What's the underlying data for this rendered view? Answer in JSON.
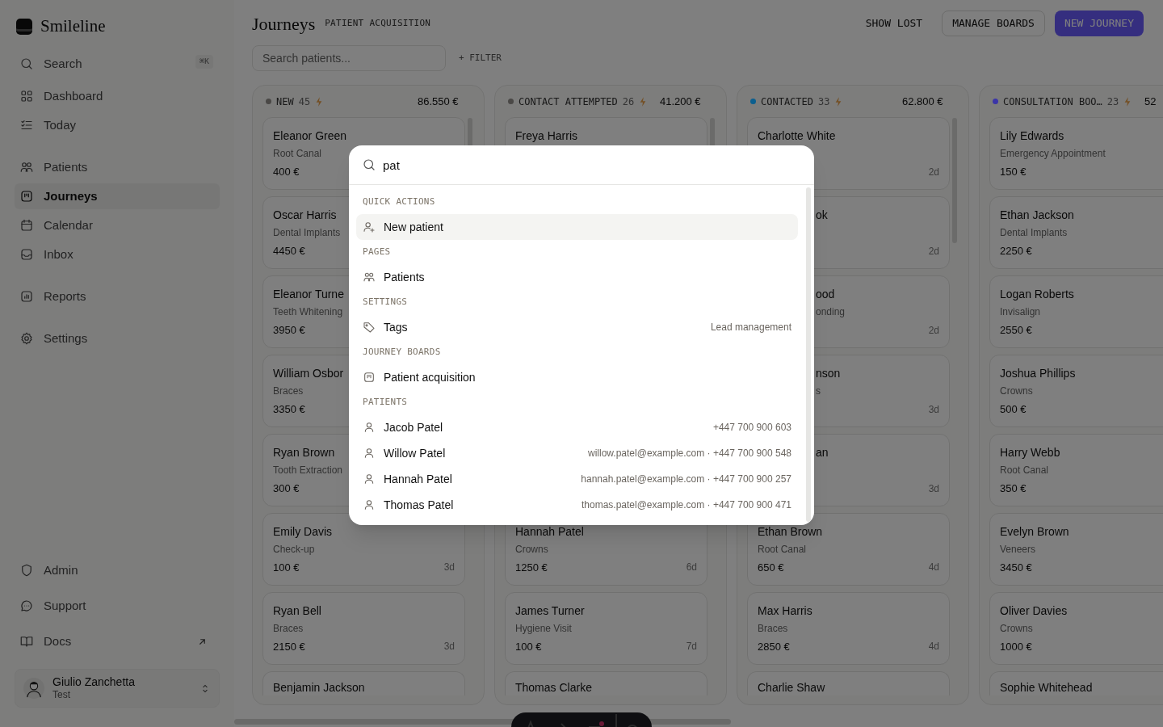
{
  "app": {
    "name": "Smileline"
  },
  "sidebar": {
    "search": {
      "label": "Search",
      "shortcut": "⌘K"
    },
    "sections": [
      [
        {
          "label": "Dashboard",
          "selected": false
        },
        {
          "label": "Today",
          "selected": false
        }
      ],
      [
        {
          "label": "Patients",
          "selected": false
        },
        {
          "label": "Journeys",
          "selected": true
        },
        {
          "label": "Calendar",
          "selected": false
        },
        {
          "label": "Inbox",
          "selected": false
        }
      ],
      [
        {
          "label": "Reports",
          "selected": false
        }
      ],
      [
        {
          "label": "Settings",
          "selected": false
        }
      ]
    ],
    "footer_items": [
      {
        "label": "Admin",
        "external": false
      },
      {
        "label": "Support",
        "external": false
      },
      {
        "label": "Docs",
        "external": true
      }
    ],
    "user": {
      "name": "Giulio Zanchetta",
      "role": "Test"
    }
  },
  "header": {
    "title": "Journeys",
    "subtitle": "PATIENT ACQUISITION",
    "buttons": [
      {
        "label": "SHOW LOST",
        "kind": "plain"
      },
      {
        "label": "MANAGE BOARDS",
        "kind": "outline"
      },
      {
        "label": "NEW JOURNEY",
        "kind": "primary"
      }
    ]
  },
  "toolbar": {
    "search_placeholder": "Search patients...",
    "filter": "+ FILTER"
  },
  "columns": [
    {
      "title": "NEW",
      "count": "45",
      "total": "86.550 €",
      "color": "#4a4846",
      "cards": [
        {
          "name": "Eleanor Green",
          "treatment": "Root Canal",
          "price": "400 €"
        },
        {
          "name": "Oscar Harris",
          "treatment": "Dental Implants",
          "price": "4450 €"
        },
        {
          "name": "Eleanor Turne",
          "treatment": "Teeth Whitening",
          "price": "3950 €"
        },
        {
          "name": "William Osbor",
          "treatment": "Braces",
          "price": "3350 €"
        },
        {
          "name": "Ryan Brown",
          "treatment": "Tooth Extraction",
          "price": "300 €"
        },
        {
          "name": "Emily Davis",
          "treatment": "Check-up",
          "price": "100 €",
          "age": "3d"
        },
        {
          "name": "Ryan Bell",
          "treatment": "Braces",
          "price": "2150 €",
          "age": "3d"
        },
        {
          "name": "Benjamin Jackson",
          "kind": "cut"
        }
      ]
    },
    {
      "title": "CONTACT ATTEMPTED",
      "count": "26",
      "total": "41.200 €",
      "color": "#4a4846",
      "cards": [
        {
          "name": "Freya Harris"
        },
        {
          "name": "Hannah Patel",
          "treatment": "Crowns",
          "price": "1250 €",
          "age": "6d"
        },
        {
          "name": "James Turner",
          "treatment": "Hygiene Visit",
          "price": "100 €",
          "age": "7d"
        },
        {
          "name": "Thomas Clarke",
          "kind": "cut"
        }
      ]
    },
    {
      "title": "CONTACTED",
      "count": "33",
      "total": "62.800 €",
      "color": "#0b5f8f",
      "cards": [
        {
          "name": "Charlotte White",
          "age": "2d"
        },
        {
          "name": "ok",
          "age": "2d",
          "kind": "partial"
        },
        {
          "name": "ood",
          "treatment": "onding",
          "age": "2d",
          "kind": "partial"
        },
        {
          "name": "nson",
          "treatment": "s",
          "age": "3d",
          "kind": "partial"
        },
        {
          "name": "an",
          "age": "3d",
          "kind": "partial"
        },
        {
          "name": "Ethan Brown",
          "treatment": "Root Canal",
          "price": "650 €",
          "age": "4d"
        },
        {
          "name": "Max Harris",
          "treatment": "Braces",
          "price": "2850 €",
          "age": "4d"
        },
        {
          "name": "Charlie Shaw",
          "kind": "cut"
        }
      ]
    },
    {
      "title": "CONSULTATION BOO…",
      "count": "23",
      "total": "52",
      "color": "#3b35a8",
      "cards": [
        {
          "name": "Lily Edwards",
          "treatment": "Emergency Appointment",
          "price": "150 €"
        },
        {
          "name": "Ethan Jackson",
          "treatment": "Dental Implants",
          "price": "2250 €"
        },
        {
          "name": "Logan Roberts",
          "treatment": "Invisalign",
          "price": "2550 €"
        },
        {
          "name": "Joshua Phillips",
          "treatment": "Crowns",
          "price": "500 €"
        },
        {
          "name": "Harry Webb",
          "treatment": "Root Canal",
          "price": "350 €"
        },
        {
          "name": "Evelyn Brown",
          "treatment": "Veneers",
          "price": "3450 €"
        },
        {
          "name": "Oliver Davies",
          "treatment": "Crowns",
          "price": "1000 €"
        },
        {
          "name": "Sophie Whitehead",
          "kind": "cut"
        }
      ]
    }
  ],
  "command_palette": {
    "query": "pat",
    "groups": [
      {
        "heading": "QUICK ACTIONS",
        "items": [
          {
            "label": "New patient",
            "selected": true
          }
        ]
      },
      {
        "heading": "PAGES",
        "items": [
          {
            "label": "Patients",
            "selected": false
          }
        ]
      },
      {
        "heading": "SETTINGS",
        "items": [
          {
            "label": "Tags",
            "detail": "Lead management",
            "selected": false
          }
        ]
      },
      {
        "heading": "JOURNEY BOARDS",
        "items": [
          {
            "label": "Patient acquisition",
            "selected": false
          }
        ]
      },
      {
        "heading": "PATIENTS",
        "items": [
          {
            "label": "Jacob Patel",
            "detail": "+447 700 900 603",
            "selected": false
          },
          {
            "label": "Willow Patel",
            "detail": "willow.patel@example.com · +447 700 900 548",
            "selected": false
          },
          {
            "label": "Hannah Patel",
            "detail": "hannah.patel@example.com · +447 700 900 257",
            "selected": false
          },
          {
            "label": "Thomas Patel",
            "detail": "thomas.patel@example.com · +447 700 900 471",
            "selected": false
          }
        ]
      }
    ]
  }
}
